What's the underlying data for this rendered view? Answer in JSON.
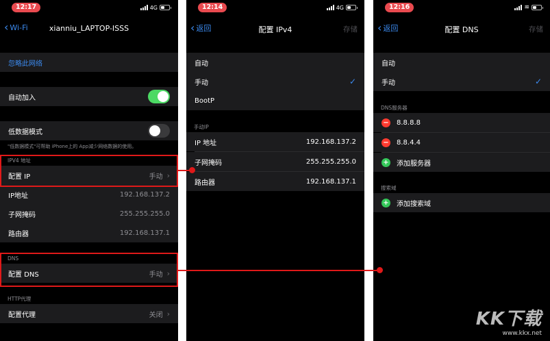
{
  "screen1": {
    "time": "12:17",
    "signal": "4G",
    "back_label": "Wi-Fi",
    "title": "xianniu_LAPTOP-ISSS",
    "forget": "忽略此网络",
    "auto_join": {
      "label": "自动加入",
      "on": true
    },
    "low_data": {
      "label": "低数据模式",
      "on": false
    },
    "low_data_note": "\"低数据模式\"可帮助 iPhone上的 App减少网络数据的使用。",
    "ipv4_header": "IPV4 地址",
    "configure_ip": {
      "label": "配置 IP",
      "value": "手动"
    },
    "ip_address": {
      "label": "IP地址",
      "value": "192.168.137.2"
    },
    "subnet": {
      "label": "子网掩码",
      "value": "255.255.255.0"
    },
    "router": {
      "label": "路由器",
      "value": "192.168.137.1"
    },
    "dns_header": "DNS",
    "configure_dns": {
      "label": "配置 DNS",
      "value": "手动"
    },
    "http_header": "HTTP代理",
    "configure_proxy": {
      "label": "配置代理",
      "value": "关闭"
    }
  },
  "screen2": {
    "time": "12:14",
    "signal": "4G",
    "back_label": "返回",
    "title": "配置 IPv4",
    "save": "存储",
    "options": [
      "自动",
      "手动",
      "BootP"
    ],
    "selected": "手动",
    "manual_header": "手动IP",
    "ip_address": {
      "label": "IP 地址",
      "value": "192.168.137.2"
    },
    "subnet": {
      "label": "子网掩码",
      "value": "255.255.255.0"
    },
    "router": {
      "label": "路由器",
      "value": "192.168.137.1"
    }
  },
  "screen3": {
    "time": "12:16",
    "back_label": "返回",
    "title": "配置 DNS",
    "save": "存储",
    "options": [
      "自动",
      "手动"
    ],
    "selected": "手动",
    "dns_header": "DNS服务器",
    "servers": [
      "8.8.8.8",
      "8.8.4.4"
    ],
    "add_server": "添加服务器",
    "search_header": "搜索域",
    "add_domain": "添加搜索域"
  },
  "watermark": {
    "brand": "KK下载",
    "url": "www.kkx.net"
  },
  "colors": {
    "accent": "#3c8bf0",
    "toggle_on": "#4cd964",
    "annotation": "#e01919",
    "time_pill": "#e94a4f"
  },
  "icons": [
    "chevron-left-icon",
    "chevron-right-icon",
    "checkmark-icon",
    "minus-circle-icon",
    "plus-circle-icon",
    "signal-icon",
    "battery-icon",
    "wifi-icon"
  ]
}
